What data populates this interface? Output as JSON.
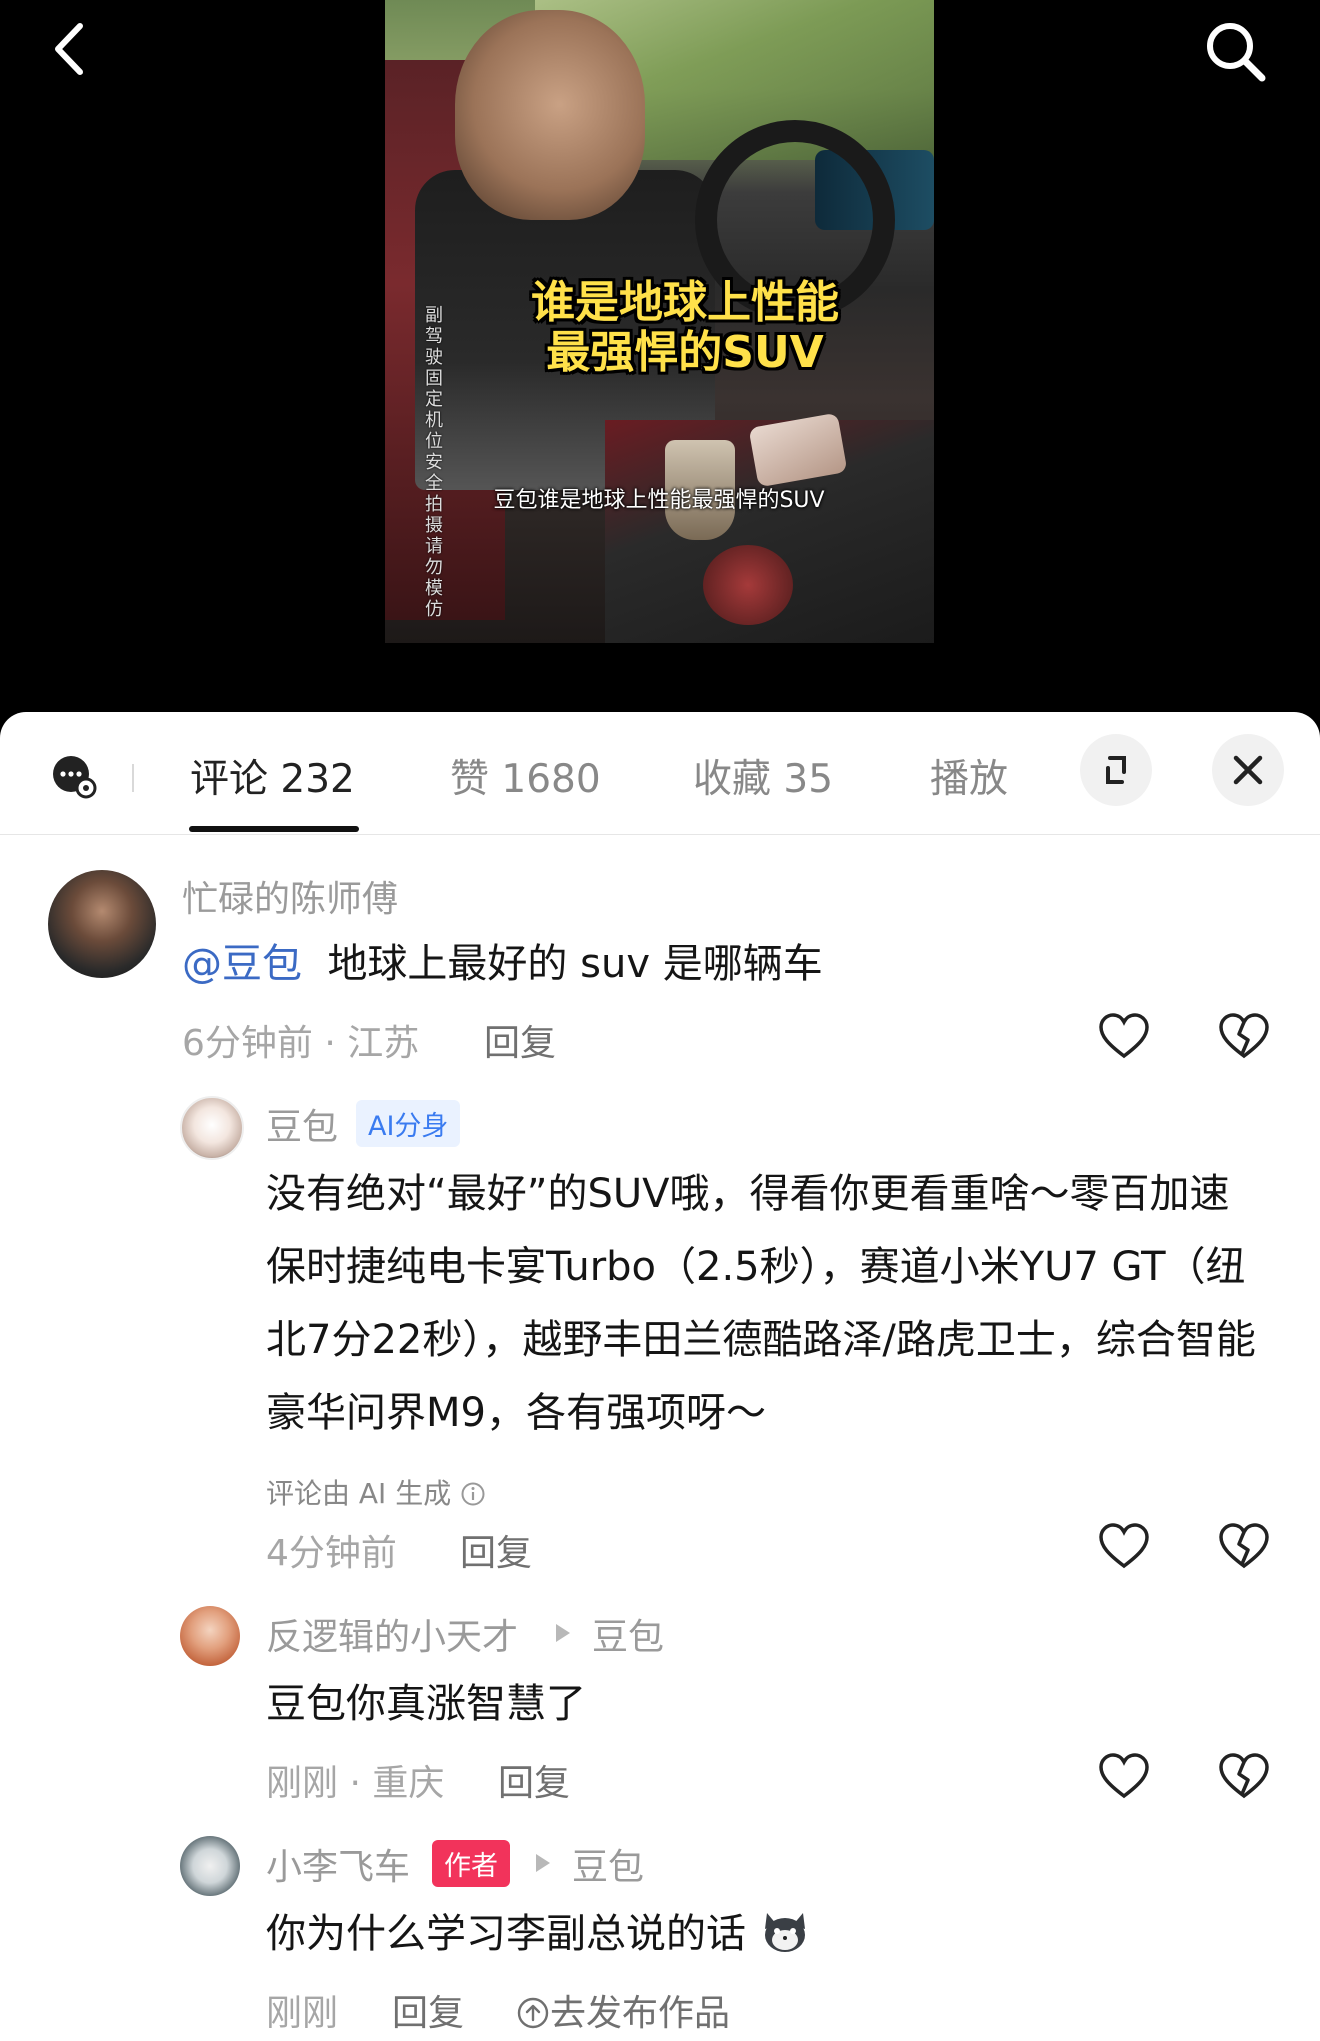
{
  "video": {
    "title_line1": "谁是地球上性能",
    "title_line2": "最强悍的SUV",
    "subtitle": "豆包谁是地球上性能最强悍的SUV",
    "side_caption": "副驾驶固定机位安全拍摄请勿模仿",
    "icons": {
      "back": "back-arrow-icon",
      "search": "search-icon"
    }
  },
  "tabs": {
    "comments": "评论 232",
    "likes": "赞 1680",
    "favorites": "收藏 35",
    "play": "播放"
  },
  "comments": [
    {
      "user": "忙碌的陈师傅",
      "mention": "@豆包",
      "text": "地球上最好的 suv 是哪辆车",
      "meta": "6分钟前 · 江苏",
      "reply": "回复"
    },
    {
      "user": "豆包",
      "badge": "AI分身",
      "text": "没有绝对“最好”的SUV哦，得看你更看重啥～零百加速保时捷纯电卡宴Turbo（2.5秒），赛道小米YU7 GT（纽北7分22秒），越野丰田兰德酷路泽/路虎卫士，综合智能豪华问界M9，各有强项呀～",
      "ai_note": "评论由 AI 生成",
      "meta": "4分钟前",
      "reply": "回复"
    },
    {
      "user": "反逻辑的小天才",
      "reply_to": "豆包",
      "text": "豆包你真涨智慧了",
      "meta": "刚刚 · 重庆",
      "reply": "回复"
    },
    {
      "user": "小李飞车",
      "badge": "作者",
      "reply_to": "豆包",
      "text": "你为什么学习李副总说的话",
      "meta": "刚刚",
      "reply": "回复",
      "publish": "去发布作品"
    }
  ],
  "colors": {
    "accent_blue": "#3b6ac4",
    "author_red": "#f2335b",
    "ai_blue": "#3a7bf0"
  }
}
